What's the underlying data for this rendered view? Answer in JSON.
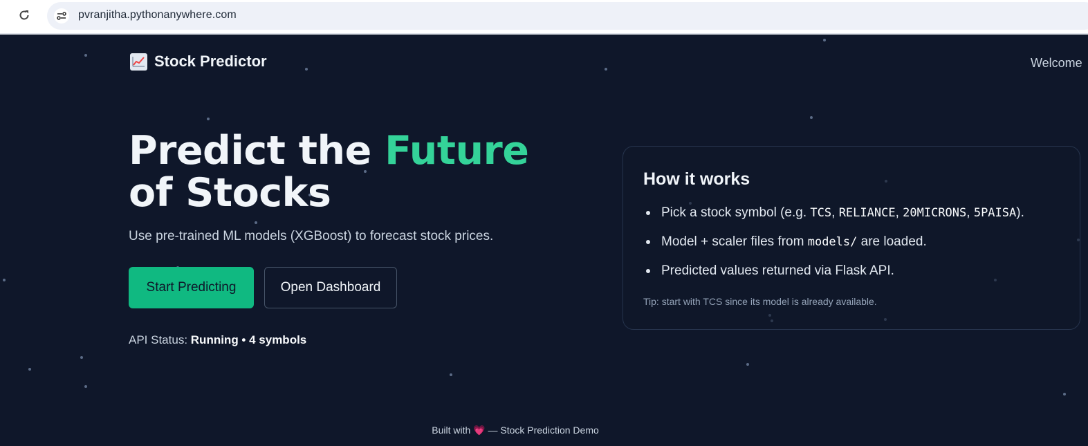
{
  "browser": {
    "url": "pvranjitha.pythonanywhere.com",
    "reload_icon": "reload-icon",
    "site_info_icon": "site-settings-icon"
  },
  "nav": {
    "brand_icon": "chart-increasing-icon",
    "brand": "Stock Predictor",
    "welcome": "Welcome"
  },
  "hero": {
    "title_part1": "Predict the ",
    "title_accent": "Future",
    "title_part2": " of Stocks",
    "subtitle": "Use pre-trained ML models (XGBoost) to forecast stock prices.",
    "primary_button": "Start Predicting",
    "secondary_button": "Open Dashboard",
    "api_status_label": "API Status:",
    "api_status_value": "Running • 4 symbols"
  },
  "card": {
    "title": "How it works",
    "item1_prefix": "Pick a stock symbol (e.g. ",
    "symbols": [
      "TCS",
      "RELIANCE",
      "20MICRONS",
      "5PAISA"
    ],
    "item1_suffix": ").",
    "item2_prefix": "Model + scaler files from ",
    "item2_code": "models/",
    "item2_suffix": " are loaded.",
    "item3": "Predicted values returned via Flask API.",
    "tip": "Tip: start with TCS since its model is already available."
  },
  "footer": {
    "prefix": "Built with ",
    "heart": "💗",
    "suffix": " — Stock Prediction Demo"
  },
  "colors": {
    "background": "#0f172a",
    "accent": "#34d399",
    "primary_button": "#10b981"
  }
}
